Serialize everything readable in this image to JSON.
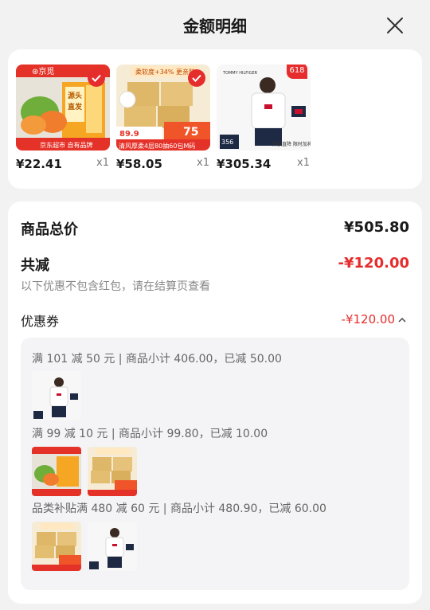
{
  "header": {
    "title": "金额明细"
  },
  "products": [
    {
      "price": "¥22.41",
      "qty": "x1",
      "image": "melon-box",
      "badge_lines": [
        "源头直发"
      ],
      "caption": "京东超市 自有品牌",
      "brand": "京觅"
    },
    {
      "price": "¥58.05",
      "qty": "x1",
      "image": "tissue-pack",
      "promo": "柔软度+34% 更亲肤",
      "price_tag": "89.9",
      "discount_tag": "75",
      "caption": "清风厚柔4层80抽60包M码"
    },
    {
      "price": "¥305.34",
      "qty": "x1",
      "image": "tshirt-model",
      "brand": "TOMMY HILFIGER",
      "badge": "618",
      "bottom_text": "撑欧直降 限时加补"
    }
  ],
  "summary": {
    "total_label": "商品总价",
    "total_value": "¥505.80",
    "discount_label": "共减",
    "discount_value": "-¥120.00",
    "note": "以下优惠不包含红包，请在结算页查看",
    "coupon_label": "优惠券",
    "coupon_value": "-¥120.00"
  },
  "coupon_rules": [
    {
      "text": "满 101 减 50 元 | 商品小计 406.00，已减 50.00",
      "items": [
        "tshirt-model"
      ]
    },
    {
      "text": "满 99 减 10 元 | 商品小计 99.80，已减 10.00",
      "items": [
        "melon-box",
        "tissue-pack"
      ]
    },
    {
      "text": "品类补贴满 480 减 60 元 | 商品小计 480.90，已减 60.00",
      "items": [
        "tissue-pack",
        "tshirt-model"
      ]
    }
  ],
  "colors": {
    "accent": "#e62d2d",
    "background": "#f2f2f2",
    "card": "#ffffff",
    "panel": "#f4f4f6"
  }
}
